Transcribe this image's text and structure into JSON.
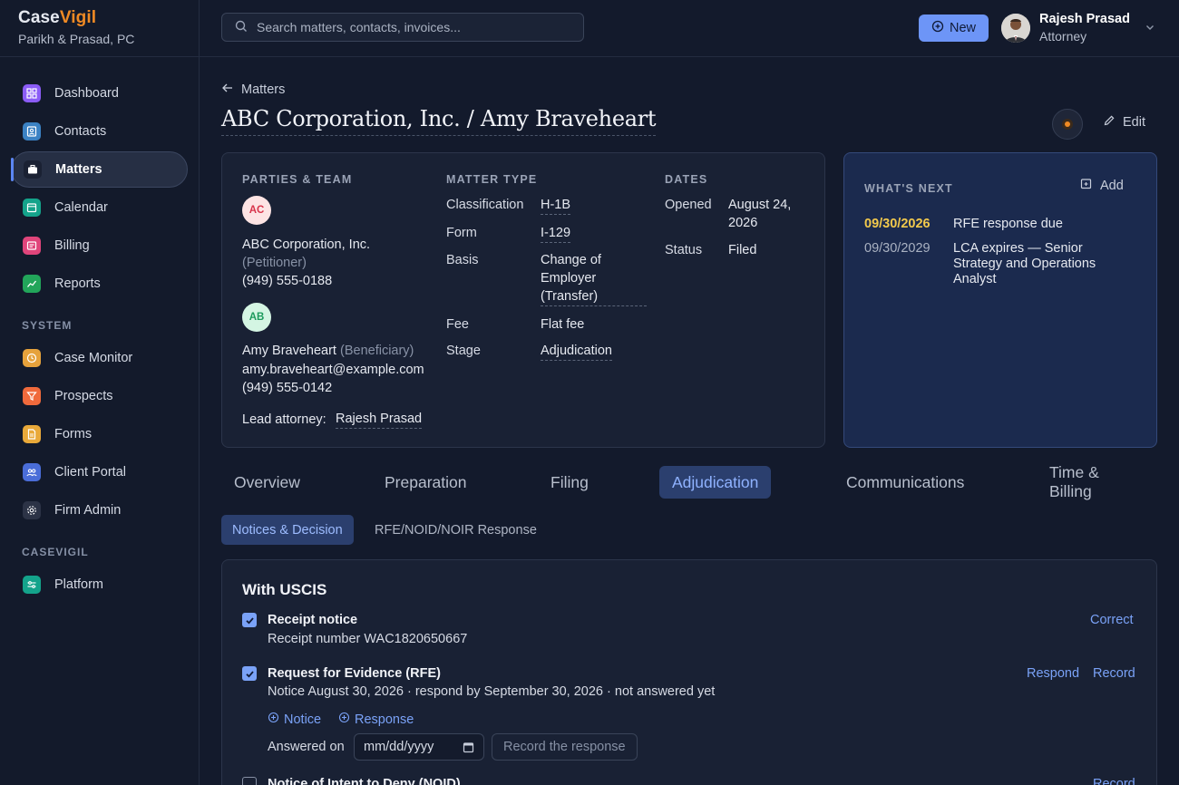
{
  "brand": {
    "name_part1": "Case",
    "name_part2": "Vigil",
    "firm": "Parikh & Prasad, PC",
    "accent": "#f08a24"
  },
  "sidebar": {
    "items": [
      {
        "label": "Dashboard",
        "icon": "grid-icon",
        "color": "#8b5cf6"
      },
      {
        "label": "Contacts",
        "icon": "contact-card-icon",
        "color": "#3b82c4"
      },
      {
        "label": "Matters",
        "icon": "briefcase-icon",
        "color": "#2a3348"
      },
      {
        "label": "Calendar",
        "icon": "calendar-icon",
        "color": "#14a38b"
      },
      {
        "label": "Billing",
        "icon": "receipt-icon",
        "color": "#e0457b"
      },
      {
        "label": "Reports",
        "icon": "chart-line-icon",
        "color": "#22a55a"
      }
    ],
    "system_label": "SYSTEM",
    "system_items": [
      {
        "label": "Case Monitor",
        "icon": "clock-icon",
        "color": "#e6a23c"
      },
      {
        "label": "Prospects",
        "icon": "funnel-icon",
        "color": "#f06a3c"
      },
      {
        "label": "Forms",
        "icon": "document-icon",
        "color": "#e9a93a"
      },
      {
        "label": "Client Portal",
        "icon": "users-icon",
        "color": "#4a6dd8"
      },
      {
        "label": "Firm Admin",
        "icon": "gear-icon",
        "color": "#3b4257"
      }
    ],
    "casevigil_label": "CASEVIGIL",
    "casevigil_items": [
      {
        "label": "Platform",
        "icon": "sliders-icon",
        "color": "#14a38b"
      }
    ]
  },
  "topbar": {
    "search_placeholder": "Search matters, contacts, invoices...",
    "new_label": "New",
    "user_name": "Rajesh Prasad",
    "user_role": "Attorney"
  },
  "page": {
    "breadcrumb": "Matters",
    "title": "ABC Corporation, Inc. / Amy Braveheart",
    "edit_label": "Edit"
  },
  "parties": {
    "heading": "PARTIES & TEAM",
    "petitioner_initials": "AC",
    "petitioner_name": "ABC Corporation, Inc.",
    "petitioner_role": "(Petitioner)",
    "petitioner_phone": "(949) 555-0188",
    "beneficiary_initials": "AB",
    "beneficiary_name": "Amy Braveheart",
    "beneficiary_role": "(Beneficiary)",
    "beneficiary_email": "amy.braveheart@example.com",
    "beneficiary_phone": "(949) 555-0142",
    "lead_label": "Lead attorney:",
    "lead_value": "Rajesh Prasad"
  },
  "matter_type": {
    "heading": "MATTER TYPE",
    "rows": [
      {
        "key": "Classification",
        "value": "H-1B"
      },
      {
        "key": "Form",
        "value": "I-129"
      },
      {
        "key": "Basis",
        "value": "Change of Employer (Transfer)"
      },
      {
        "key": "Fee",
        "value": "Flat fee"
      },
      {
        "key": "Stage",
        "value": "Adjudication"
      }
    ]
  },
  "dates": {
    "heading": "DATES",
    "opened_label": "Opened",
    "opened_value": "August 24, 2026",
    "status_label": "Status",
    "status_value": "Filed"
  },
  "whats_next": {
    "heading": "WHAT'S NEXT",
    "add_label": "Add",
    "items": [
      {
        "date": "09/30/2026",
        "text": "RFE response due",
        "highlight": "#f2c94c"
      },
      {
        "date": "09/30/2029",
        "text": "LCA expires — Senior Strategy and Operations Analyst"
      }
    ]
  },
  "tabs": [
    "Overview",
    "Preparation",
    "Filing",
    "Adjudication",
    "Communications",
    "Time & Billing"
  ],
  "subtabs": [
    "Notices & Decision",
    "RFE/NOID/NOIR Response"
  ],
  "uscis": {
    "heading": "With USCIS",
    "receipt_title": "Receipt notice",
    "receipt_detail": "Receipt number WAC1820650667",
    "receipt_action": "Correct",
    "rfe_title": "Request for Evidence (RFE)",
    "rfe_detail": "Notice August 30, 2026 · respond by September 30, 2026 · not answered yet",
    "rfe_action_respond": "Respond",
    "rfe_action_record": "Record",
    "notice_link": "Notice",
    "response_link": "Response",
    "answered_label": "Answered on",
    "date_placeholder": "mm/dd/yyyy",
    "record_response_label": "Record the response",
    "noid_title": "Notice of Intent to Deny (NOID)",
    "noid_action": "Record"
  }
}
